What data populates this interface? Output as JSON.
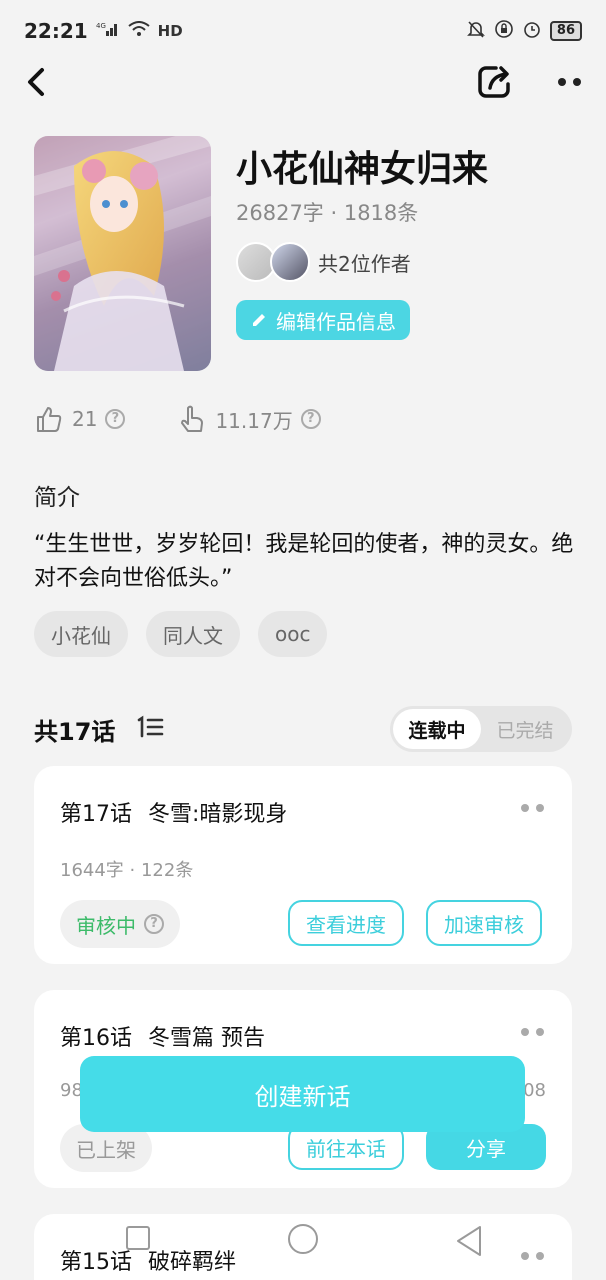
{
  "status_bar": {
    "time": "22:21",
    "network": "4G",
    "hd": "HD",
    "battery": "86"
  },
  "work": {
    "title": "小花仙神女归来",
    "meta": "26827字 · 1818条",
    "authors_label": "共2位作者",
    "edit_label": "编辑作品信息"
  },
  "stats": {
    "likes": "21",
    "views": "11.17万"
  },
  "intro": {
    "heading": "简介",
    "text": "“生生世世，岁岁轮回！我是轮回的使者，神的灵女。绝对不会向世俗低头。”",
    "tags": [
      "小花仙",
      "同人文",
      "ooc"
    ]
  },
  "chapters": {
    "count_label": "共17话",
    "toggle": [
      "连载中",
      "已完结"
    ],
    "items": [
      {
        "num": "第17话",
        "title": "冬雪:暗影现身",
        "meta": "1644字 · 122条",
        "status": "审核中",
        "btn1": "查看进度",
        "btn2": "加速审核"
      },
      {
        "num": "第16话",
        "title": "冬雪篇 预告",
        "meta_left": "98",
        "meta_right": "08",
        "status": "已上架",
        "btn1": "前往本话",
        "btn2": "分享"
      },
      {
        "num": "第15话",
        "title": "破碎羁绊"
      }
    ]
  },
  "create_button": "创建新话",
  "colors": {
    "accent": "#45d8e5",
    "review_green": "#3dbb6a"
  }
}
